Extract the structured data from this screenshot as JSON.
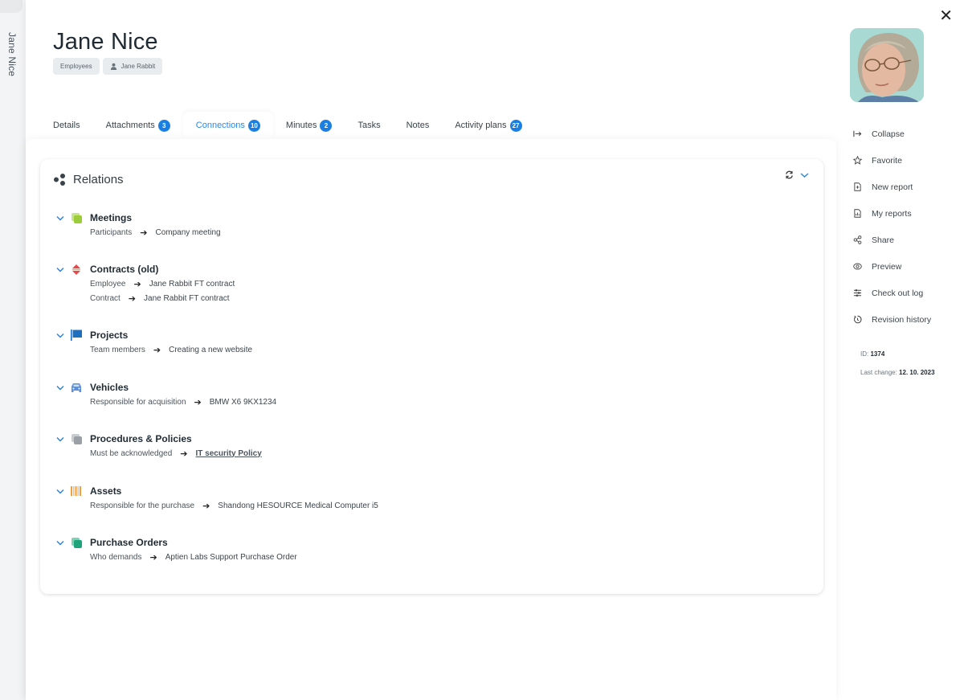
{
  "side_strip": {
    "label": "Jane Nice"
  },
  "header": {
    "title": "Jane Nice",
    "chips": [
      {
        "label": "Employees",
        "icon": ""
      },
      {
        "label": "Jane Rabbit",
        "icon": "person-icon"
      }
    ],
    "close_icon": "close-icon"
  },
  "tabs": [
    {
      "label": "Details",
      "badge": null,
      "active": false
    },
    {
      "label": "Attachments",
      "badge": "3",
      "active": false
    },
    {
      "label": "Connections",
      "badge": "10",
      "active": true
    },
    {
      "label": "Minutes",
      "badge": "2",
      "active": false
    },
    {
      "label": "Tasks",
      "badge": null,
      "active": false
    },
    {
      "label": "Notes",
      "badge": null,
      "active": false
    },
    {
      "label": "Activity plans",
      "badge": "27",
      "active": false
    }
  ],
  "relations": {
    "title": "Relations",
    "groups": [
      {
        "title": "Meetings",
        "icon": "meetings-icon",
        "color": "#9ccc3a",
        "rows": [
          {
            "role": "Participants",
            "target": "Company meeting",
            "link": false
          }
        ]
      },
      {
        "title": "Contracts (old)",
        "icon": "contracts-icon",
        "color": "#e5484d",
        "rows": [
          {
            "role": "Employee",
            "target": "Jane Rabbit FT contract",
            "link": false
          },
          {
            "role": "Contract",
            "target": "Jane Rabbit FT contract",
            "link": false
          }
        ]
      },
      {
        "title": "Projects",
        "icon": "flag-icon",
        "color": "#1f6fc0",
        "rows": [
          {
            "role": "Team members",
            "target": "Creating a new website",
            "link": false
          }
        ]
      },
      {
        "title": "Vehicles",
        "icon": "car-icon",
        "color": "#5b8fe0",
        "rows": [
          {
            "role": "Responsible for acquisition",
            "target": "BMW X6 9KX1234",
            "link": false
          }
        ]
      },
      {
        "title": "Procedures & Policies",
        "icon": "policies-icon",
        "color": "#9aa0a6",
        "rows": [
          {
            "role": "Must be acknowledged",
            "target": "IT security Policy",
            "link": true
          }
        ]
      },
      {
        "title": "Assets",
        "icon": "barcode-icon",
        "color": "#f0a040",
        "rows": [
          {
            "role": "Responsible for the purchase",
            "target": "Shandong HESOURCE Medical Computer i5",
            "link": false
          }
        ]
      },
      {
        "title": "Purchase Orders",
        "icon": "purchase-orders-icon",
        "color": "#1fa37a",
        "rows": [
          {
            "role": "Who demands",
            "target": "Aptien Labs Support Purchase Order",
            "link": false
          }
        ]
      }
    ]
  },
  "rail": {
    "items": [
      {
        "label": "Collapse",
        "icon": "collapse-icon"
      },
      {
        "label": "Favorite",
        "icon": "star-icon"
      },
      {
        "label": "New report",
        "icon": "new-report-icon"
      },
      {
        "label": "My reports",
        "icon": "my-reports-icon"
      },
      {
        "label": "Share",
        "icon": "share-icon"
      },
      {
        "label": "Preview",
        "icon": "eye-icon"
      },
      {
        "label": "Check out log",
        "icon": "log-icon"
      },
      {
        "label": "Revision history",
        "icon": "history-icon"
      }
    ],
    "id_label": "ID:",
    "id_value": "1374",
    "last_change_label": "Last change:",
    "last_change_value": "12. 10. 2023"
  },
  "colors": {
    "accent": "#1a7fe0",
    "active_tab": "#2a8ae0"
  }
}
